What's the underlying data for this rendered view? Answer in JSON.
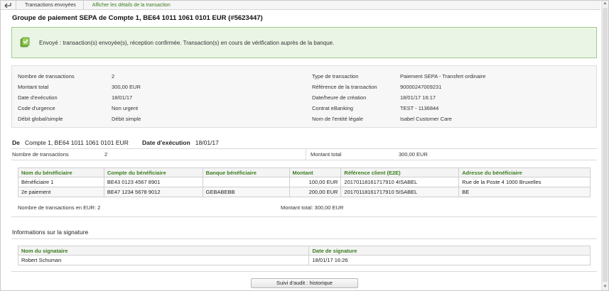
{
  "breadcrumb": {
    "items": [
      "Transactions envoyées",
      "Afficher les détails de la transaction"
    ]
  },
  "page_title": "Groupe de paiement SEPA de Compte 1, BE64 1011 1061 0101 EUR (#5623447)",
  "notice": {
    "text": "Envoyé : transaction(s) envoyée(s), réception confirmée. Transaction(s) en cours de vérification auprès de la banque.",
    "color": "#ebf5e6"
  },
  "summary": {
    "left": [
      {
        "label": "Nombre de transactions",
        "value": "2"
      },
      {
        "label": "Montant total",
        "value": "300,00 EUR"
      },
      {
        "label": "Date d'exécution",
        "value": "18/01/17"
      },
      {
        "label": "Code d'urgence",
        "value": "Non urgent"
      },
      {
        "label": "Débit global/simple",
        "value": "Débit simple"
      }
    ],
    "right": [
      {
        "label": "Type de transaction",
        "value": "Paiement SEPA - Transfert ordinaire"
      },
      {
        "label": "Référence de la transaction",
        "value": "90000247009231"
      },
      {
        "label": "Date/heure de création",
        "value": "18/01/17 16:17"
      },
      {
        "label": "Contrat eBanking",
        "value": "TEST - 1136844"
      },
      {
        "label": "Nom de l'entité légale",
        "value": "Isabel Customer Care"
      }
    ]
  },
  "from": {
    "de_label": "De",
    "account": "Compte 1, BE64 1011 1061 0101 EUR",
    "exec_label": "Date d'exécution",
    "exec_date": "18/01/17",
    "count_label": "Nombre de transactions",
    "count_value": "2",
    "total_label": "Montant total",
    "total_value": "300,00 EUR"
  },
  "beneficiaries": {
    "headers": [
      "Nom du bénéficiaire",
      "Compte du bénéficiaire",
      "Banque bénéficiaire",
      "Montant",
      "Référence client (E2E)",
      "Adresse du bénéficiaire"
    ],
    "rows": [
      [
        "Bénéficiaire 1",
        "BE43 0123 4567 8901",
        "",
        "100,00 EUR",
        "20170118161717910 4ISABEL",
        "Rue de la Poste 4 1000 Bruxelles"
      ],
      [
        "2e paiement",
        "BE47 1234 5678 9012",
        "GEBABEBB",
        "200,00 EUR",
        "20170118161717910 5ISABEL",
        "BE"
      ]
    ],
    "footer_count": "Nombre de transactions en EUR: 2",
    "footer_total": "Montant total: 300,00 EUR"
  },
  "signature": {
    "section_title": "Informations sur la signature",
    "headers": [
      "Nom du signataire",
      "Date de signature"
    ],
    "rows": [
      [
        "Robert Schuman",
        "18/01/17 16:26"
      ]
    ]
  },
  "audit_button": "Suivi d'audit : historique",
  "colors": {
    "accent": "#3b7d1f",
    "notice_border": "#9fcc88"
  }
}
